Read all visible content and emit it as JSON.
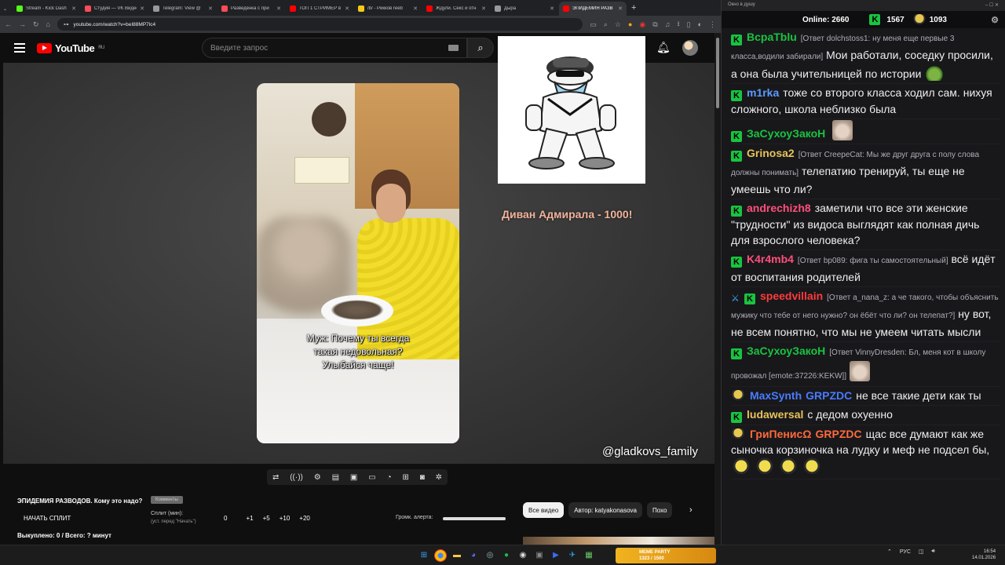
{
  "browser": {
    "tabs": [
      {
        "title": "Stream - Kick Dash",
        "color": "#53fc18",
        "active": false
      },
      {
        "title": "Студия — VK Видео",
        "color": "#ff4b57",
        "active": false
      },
      {
        "title": "Telegram: View @",
        "color": "#999999",
        "active": false
      },
      {
        "title": "Разведёнка с при",
        "color": "#ff4b57",
        "active": false
      },
      {
        "title": "ТОП 1 СТРИМЕР в",
        "color": "#ff0000",
        "active": false
      },
      {
        "title": "/b/ - Рикков reeb",
        "color": "#f6c915",
        "active": false
      },
      {
        "title": "Ждули. Секс и отн",
        "color": "#ff0000",
        "active": false
      },
      {
        "title": "Дыра",
        "color": "#999999",
        "active": false
      },
      {
        "title": "ЭПИДЕМИЯ РАЗВ",
        "color": "#ff0000",
        "active": true
      }
    ],
    "url": "youtube.com/watch?v=beI88MP7lc4"
  },
  "youtube": {
    "logo_text": "YouTube",
    "region": "RU",
    "search_placeholder": "Введите запрос"
  },
  "video": {
    "subtitle_line1": "Муж: Почему ты всегда",
    "subtitle_line2": "такая недовольная?",
    "subtitle_line3": "Улыбайся чаще!",
    "watermark": "@gladkovs_family",
    "alert_text": "Диван Адмирала - 1000!"
  },
  "below": {
    "title": "ЭПИДЕМИЯ РАЗВОДОВ. Кому это надо?",
    "badge": "Комменты",
    "split_button": "НАЧАТЬ СПЛИТ",
    "split_label": "Сплит (мин):",
    "split_hint": "(уст. перед \"Начать\")",
    "split_value": "0",
    "split_steps": [
      "+1",
      "+5",
      "+10",
      "+20"
    ],
    "volume_label": "Громк. алерта:",
    "volume_level": 1.0,
    "stats": "Выкуплено: 0 / Всего: ? минут",
    "chips": [
      "Все видео",
      "Автор: katyakonasova",
      "Похо"
    ]
  },
  "chat_window": {
    "title": "Окно в душу",
    "online_label": "Online:",
    "online_count": "2660",
    "k_count": "1567",
    "coin_count": "1093"
  },
  "chat": [
    {
      "badges": [
        "kick"
      ],
      "nick": "ВсраТblu",
      "color": "#1ac340",
      "reply": "[Ответ dolchstoss1: ну меня еще первые 3 класса,водили забирали]",
      "text": "Мои работали, соседку просили, а она была учительницей по истории",
      "emote": "frog"
    },
    {
      "badges": [
        "kick"
      ],
      "nick": "m1rka",
      "color": "#5b9cff",
      "reply": "",
      "text": "тоже со второго класса ходил сам. нихуя сложного, школа неблизко была",
      "emote": ""
    },
    {
      "badges": [
        "kick"
      ],
      "nick": "ЗаСухоуЗакоН",
      "color": "#1ac340",
      "reply": "",
      "text": "",
      "emote": "cat"
    },
    {
      "badges": [
        "kick"
      ],
      "nick": "Grinosa2",
      "color": "#e8c35a",
      "reply": "[Ответ CreepeCat: Мы же друг друга с полу слова должны понимать]",
      "text": "телепатию тренируй, ты еще не умеешь что ли?",
      "emote": ""
    },
    {
      "badges": [
        "kick"
      ],
      "nick": "andrechizh8",
      "color": "#ff4f7b",
      "reply": "",
      "text": "заметили что все эти женские \"трудности\" из видоса выглядят как полная дичь для взрослого человека?",
      "emote": ""
    },
    {
      "badges": [
        "kick"
      ],
      "nick": "K4r4mb4",
      "color": "#ff4f7b",
      "reply": "[Ответ bp089: фига ты самостоятельный]",
      "text": "всё идёт от воспитания родителей",
      "emote": ""
    },
    {
      "badges": [
        "sword",
        "kick"
      ],
      "nick": "speedvillain",
      "color": "#ff3b3b",
      "reply": "[Ответ a_nana_z: а че такого, чтобы объяснить мужику что тебе от него нужно? он ёбёт что ли? он телепат?]",
      "text": "ну вот, не всем понятно, что мы не умеем читать мысли",
      "emote": ""
    },
    {
      "badges": [
        "kick"
      ],
      "nick": "ЗаСухоуЗакоН",
      "color": "#1ac340",
      "reply": "[Ответ VinnyDresden: Бл, меня кот в школу провожал [emote:37226:KEKW]]",
      "text": "",
      "emote": "cat"
    },
    {
      "badges": [
        "pepe"
      ],
      "nick": "MaxSynth",
      "color": "#4a7bff",
      "reply": "",
      "text": "не все такие дети как ты",
      "emote": "",
      "tag": "GRPZDC"
    },
    {
      "badges": [
        "kick"
      ],
      "nick": "ludawersal",
      "color": "#e8c35a",
      "reply": "",
      "text": "с дедом охуенно",
      "emote": ""
    },
    {
      "badges": [
        "pepe"
      ],
      "nick": "ГриПенисΩ",
      "color": "#ff6a3d",
      "reply": "",
      "text": "щас все думают как же сыночка корзиночка на лудку и меф не подсел бы,",
      "emote": "pepe4",
      "tag": "GRPZDC"
    }
  ],
  "taskbar": {
    "widget_title": "MEME PARTY",
    "widget_value": "1323 / 1500",
    "lang": "РУС",
    "time": "16:54",
    "date": "14.01.2026"
  }
}
